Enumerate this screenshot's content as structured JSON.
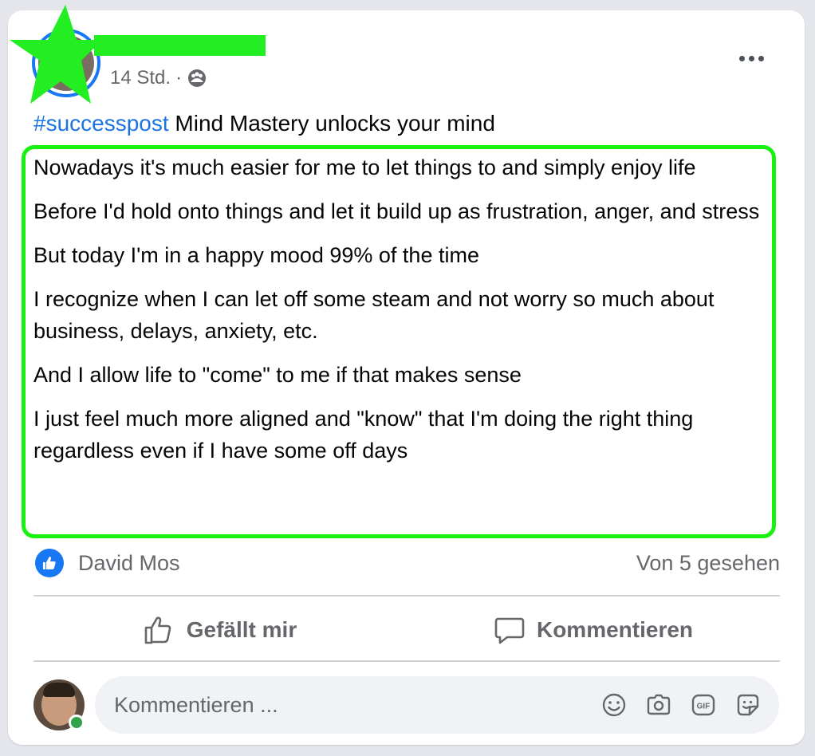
{
  "post": {
    "time": "14 Std.",
    "separator": "·",
    "audience_icon": "friends-icon",
    "headline_hashtag": "#successpost",
    "headline_text": " Mind Mastery unlocks your mind",
    "paragraphs": [
      "Nowadays it's much easier for me to let things to and simply enjoy life",
      "Before I'd hold onto things and let it build up as frustration, anger, and stress",
      "But today I'm in a happy mood 99% of the time",
      "I recognize when I can let off some steam and not worry so much about business, delays, anxiety, etc.",
      "And I allow life to \"come\" to me if that makes sense",
      "I just feel much more aligned and \"know\" that I'm doing the right thing regardless even if I have some off days"
    ]
  },
  "reactions": {
    "liker": "David Mos",
    "seen_by": "Von 5 gesehen"
  },
  "actions": {
    "like_label": "Gefällt mir",
    "comment_label": "Kommentieren"
  },
  "composer": {
    "placeholder": "Kommentieren ...",
    "icons": [
      "emoji-icon",
      "camera-icon",
      "gif-icon",
      "sticker-icon"
    ]
  },
  "colors": {
    "accent": "#1877f2",
    "hashtag": "#1b74e4",
    "highlight": "#1bf013",
    "muted_text": "#65676b",
    "online": "#31a24c"
  }
}
